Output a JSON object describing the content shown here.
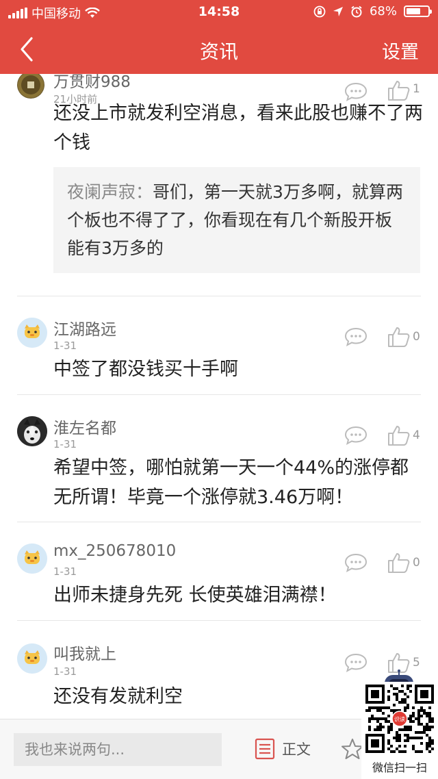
{
  "status_bar": {
    "carrier": "中国移动",
    "time": "14:58",
    "battery": "68%",
    "battery_level": 0.68
  },
  "nav": {
    "title": "资讯",
    "settings_label": "设置"
  },
  "comments": [
    {
      "username": "万贯财988",
      "time": "21小时前",
      "text": "还没上市就发利空消息，看来此股也赚不了两个钱",
      "likes": "1",
      "quote": {
        "name": "夜阑声寂",
        "sep": "：",
        "text": "哥们，第一天就3万多啊，就算两个板也不得了了，你看现在有几个新股开板能有3万多的"
      }
    },
    {
      "username": "江湖路远",
      "time": "1-31",
      "text": "中签了都没钱买十手啊",
      "likes": "0"
    },
    {
      "username": "淮左名都",
      "time": "1-31",
      "text": "希望中签，哪怕就第一天一个44%的涨停都无所谓！毕竟一个涨停就3.46万啊！",
      "likes": "4"
    },
    {
      "username": "mx_250678010",
      "time": "1-31",
      "text": "出师未捷身先死 长使英雄泪满襟！",
      "likes": "0"
    },
    {
      "username": "叫我就上",
      "time": "1-31",
      "text": "还没有发就利空",
      "likes": "5"
    }
  ],
  "bottom_bar": {
    "input_placeholder": "我也来说两句...",
    "body_label": "正文"
  },
  "overlay": {
    "qr_caption": "微信扫一扫",
    "qr_badge": "识读"
  },
  "colors": {
    "brand_red": "#e14a40",
    "avatar_blue": "#d6e9f7",
    "divider": "#e6e6e6"
  }
}
